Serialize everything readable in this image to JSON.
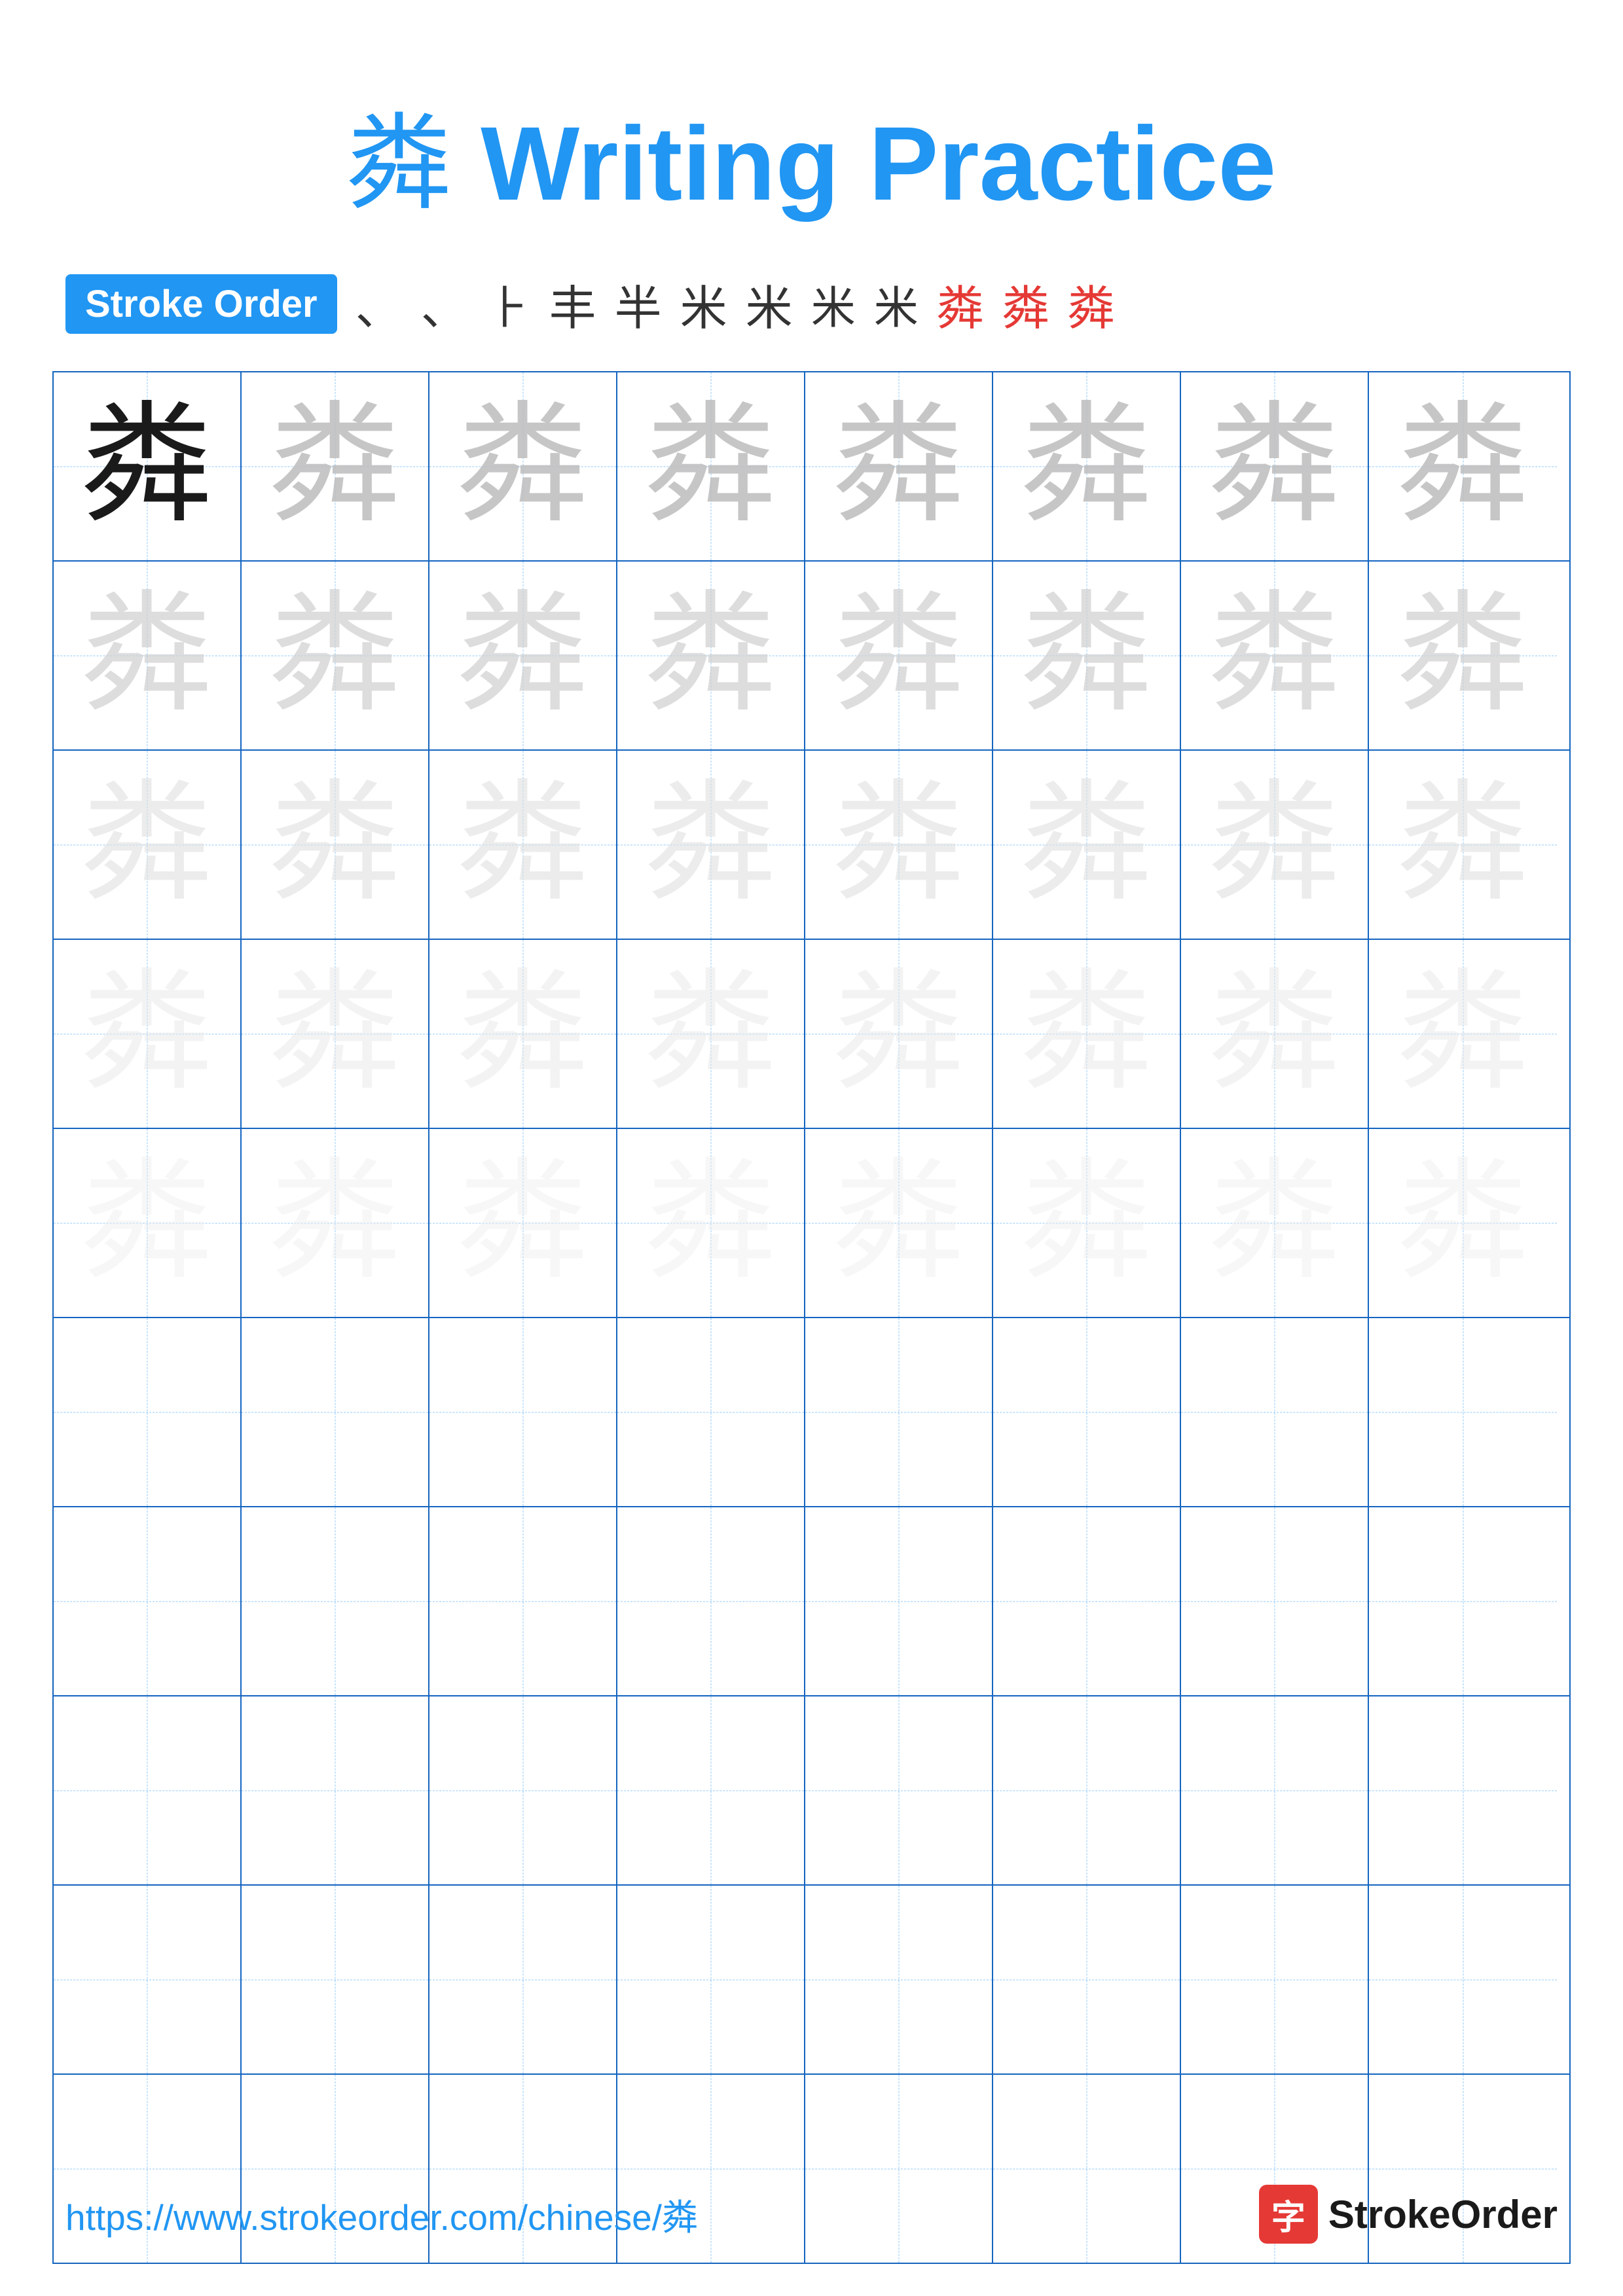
{
  "title": {
    "char": "粦",
    "text": " Writing Practice",
    "char_display": "粦"
  },
  "stroke_order": {
    "label": "Stroke Order",
    "steps": [
      "、",
      "、",
      "⺊",
      "丰",
      "半",
      "米",
      "米",
      "米",
      "米",
      "粦",
      "粦",
      "粦"
    ]
  },
  "character": "粦",
  "grid": {
    "rows": 10,
    "cols": 8,
    "practice_char": "粦"
  },
  "footer": {
    "url": "https://www.strokeorder.com/chinese/粦",
    "logo_char": "字",
    "logo_text": "StrokeOrder"
  }
}
